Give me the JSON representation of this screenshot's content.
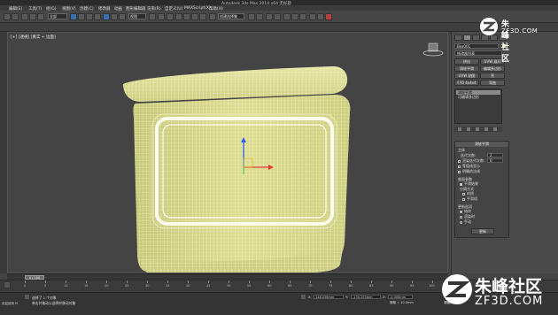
{
  "window": {
    "title": "Autodesk 3ds Max 2014 x64  无标题"
  },
  "menu": {
    "items": [
      "编辑(E)",
      "工具(T)",
      "组(G)",
      "视图(V)",
      "创建(C)",
      "修改器",
      "动画",
      "图形编辑器",
      "渲染(R)",
      "自定义(U)",
      "MAXScript(X)",
      "帮助(H)"
    ]
  },
  "toolbar": {
    "selection_filter": "全部",
    "coord_system": "视图",
    "named_selection": "创建选择集"
  },
  "viewport": {
    "label": "[+] [透视] [真实 + 边面]"
  },
  "command_panel": {
    "object_name": "Box001",
    "modifier_list": "修改器列表",
    "buttons": [
      {
        "label": "挤出"
      },
      {
        "label": "UVW 展开"
      },
      {
        "label": "涡轮平滑"
      },
      {
        "label": "编辑多边形"
      },
      {
        "label": "UVW 贴图"
      },
      {
        "label": "壳"
      },
      {
        "label": "FFD 4x4x4"
      },
      {
        "label": "弯曲"
      }
    ],
    "stack": [
      "涡轮平滑",
      "可编辑多边形"
    ],
    "rollout_title": "涡轮平滑",
    "main_label": "主体",
    "iterations_label": "迭代次数:",
    "iterations_value": "2",
    "render_iters_label": "渲染迭代次数:",
    "render_iters_value": "0",
    "isoline_label": "等值线显示",
    "explicit_normals_label": "明确的法线",
    "surface_label": "曲面参数",
    "smooth_result_label": "平滑结果",
    "separate_label": "分隔方式",
    "materials_label": "材质",
    "groups_label": "平滑组",
    "update_label": "更新选项",
    "always_label": "始终",
    "on_render_label": "渲染时",
    "manual_label": "手动",
    "update_button": "更新"
  },
  "timeline": {
    "slider_label": "0 / 100",
    "ticks": [
      "0",
      "5",
      "10",
      "15",
      "20",
      "25",
      "30",
      "35",
      "40",
      "45",
      "50",
      "55",
      "60",
      "65",
      "70",
      "75",
      "80",
      "85",
      "90",
      "95",
      "100"
    ]
  },
  "status": {
    "selected": "选择了 1 个对象",
    "prompt": "单击并拖动以选择并移动对象",
    "x_label": "X:",
    "x_value": "148.036mm",
    "y_label": "Y:",
    "y_value": "-135.253mm",
    "z_label": "Z:",
    "z_value": "-0.000mm",
    "grid": "栅格 = 10.0mm",
    "autokey": "自动关键点",
    "setkey": "设置关键点",
    "welcome": "欢迎使用 M"
  },
  "watermark": {
    "brand_cn": "朱峰社区",
    "brand_url": "ZF3D.COM"
  },
  "colors": {
    "mesh_fill": "#d9d98a",
    "mesh_wire": "#f4f4dc",
    "viewport_bg": "#444444",
    "panel_bg": "#4a4a4a",
    "axis_x": "#e23a3a",
    "axis_y": "#2ecc40",
    "axis_z": "#2f5fe8"
  }
}
